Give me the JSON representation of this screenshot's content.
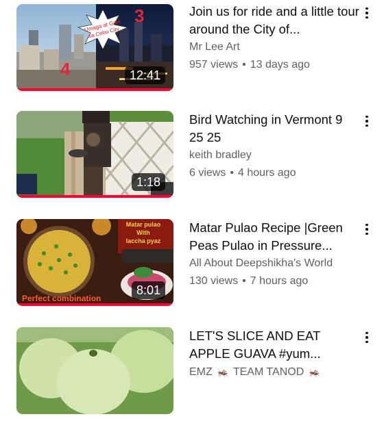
{
  "colors": {
    "progress": "#ff0033",
    "title": "#0f0f0f",
    "meta": "#606060"
  },
  "videos": [
    {
      "title": "Join us for ride and a little tour around the City of...",
      "channel": "Mr Lee Art",
      "views": "957 views",
      "separator": "•",
      "age": "13 days ago",
      "duration": "12:41",
      "thumb_text": "Umaga at Gabi sa Cebu City",
      "thumb_numbers": [
        "3",
        "4"
      ],
      "watched_fraction": 1.0
    },
    {
      "title": "Bird Watching in Vermont 9 25 25",
      "channel": "keith bradley",
      "views": "6 views",
      "separator": "•",
      "age": "4 hours ago",
      "duration": "1:18",
      "watched_fraction": 1.0
    },
    {
      "title": "Matar Pulao Recipe |Green Peas Pulao in Pressure...",
      "channel": "All About Deepshikha's World",
      "views": "130 views",
      "separator": "•",
      "age": "7 hours ago",
      "duration": "8:01",
      "thumb_caption_top": "Matar pulao With laccha pyaz",
      "thumb_caption_bottom": "Perfect combination",
      "watched_fraction": 1.0
    },
    {
      "title": "LET'S SLICE AND EAT APPLE GUAVA #yum...",
      "channel_part1": "EMZ",
      "channel_part2": "TEAM TANOD",
      "icon": "cricket-icon"
    }
  ],
  "menu_icon": "more-vert-icon"
}
